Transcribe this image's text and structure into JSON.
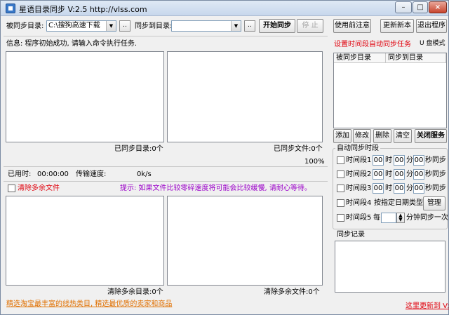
{
  "window": {
    "title": "星语目录同步 V:2.5 http://vlss.com",
    "controls": {
      "minimize": "–",
      "maximize": "□",
      "close": "×"
    }
  },
  "toolbar": {
    "source_label": "被同步目录:",
    "source_value": "C:\\搜狗高速下载",
    "browse": "..",
    "target_label": "同步到目录:",
    "target_value": "",
    "start_sync": "开始同步",
    "stop": "停 止",
    "notes": "使用前注意",
    "update": "更新新本",
    "exit": "退出程序"
  },
  "info": {
    "text": "信息: 程序初始成功, 请输入命令执行任务."
  },
  "top_panels": {
    "synced_dirs": "已同步目录:0个",
    "synced_files": "已同步文件:0个",
    "progress": "100%"
  },
  "status": {
    "elapsed_label": "已用时:",
    "elapsed_value": "00:00:00",
    "speed_label": "传输速度:",
    "speed_value": "0k/s"
  },
  "options": {
    "clear_extra": "清除多余文件",
    "hint": "提示: 如果文件比较零碎速度将可能会比较缓慢, 请耐心等待。"
  },
  "bottom_panels": {
    "cleared_dirs": "清除多余目录:0个",
    "cleared_files": "清除多余文件:0个"
  },
  "footer": {
    "link": "精选淘宝最丰富的线热类目, 精选最优质的卖家和商品",
    "update_link": "这里更新到 V:"
  },
  "right": {
    "auto_task_title": "设置时间段自动同步任务",
    "usb_mode": "U 盘模式",
    "table_headers": [
      "被同步目录",
      "同步到目录"
    ],
    "buttons": {
      "add": "添加",
      "edit": "修改",
      "delete": "删除",
      "clear": "清空",
      "shutdown": "关闭服务"
    },
    "auto_group_title": "自动同步时段",
    "periods": [
      {
        "label": "时间段1",
        "hour": "00",
        "h_unit": "时",
        "minute": "00",
        "m_unit": "分",
        "second": "00",
        "s_unit": "秒同步"
      },
      {
        "label": "时间段2",
        "hour": "00",
        "h_unit": "时",
        "minute": "00",
        "m_unit": "分",
        "second": "00",
        "s_unit": "秒同步"
      },
      {
        "label": "时间段3",
        "hour": "00",
        "h_unit": "时",
        "minute": "00",
        "m_unit": "分",
        "second": "00",
        "s_unit": "秒同步"
      }
    ],
    "period4_label": "时间段4",
    "period4_text": "按指定日期类型",
    "manage": "管理",
    "period5_label": "时间段5",
    "period5_every": "每",
    "period5_value": "",
    "period5_text": "分钟同步一次",
    "log_title": "同步记录"
  },
  "colors": {
    "accent_red": "#e0000c",
    "hint_purple": "#9b00c9",
    "footer_orange": "#e07000"
  }
}
